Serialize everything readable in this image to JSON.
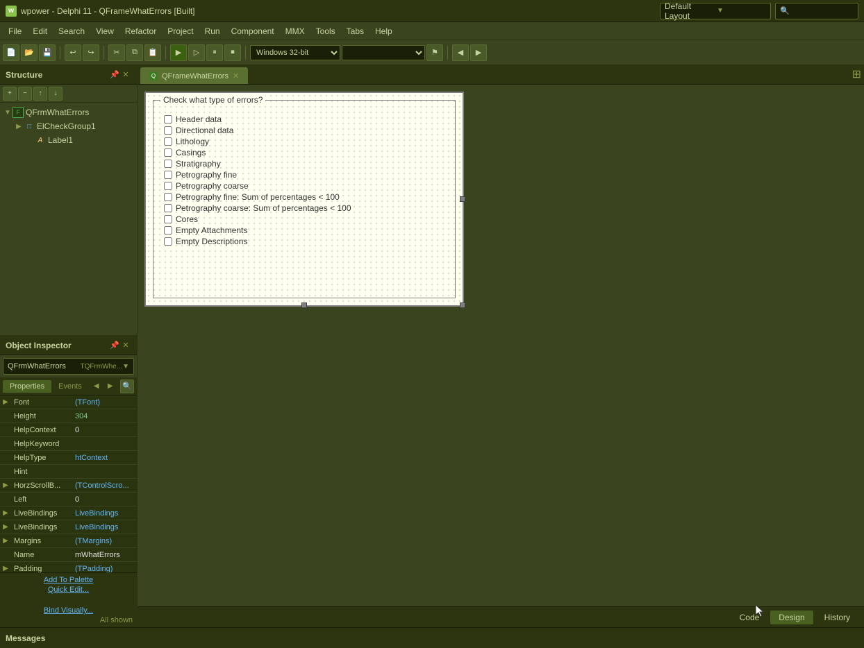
{
  "titlebar": {
    "icon": "w",
    "title": "wpower - Delphi 11 - QFrameWhatErrors [Built]",
    "layout_label": "Default Layout",
    "search_placeholder": "Search"
  },
  "menu": {
    "items": [
      "File",
      "Edit",
      "Search",
      "View",
      "Refactor",
      "Project",
      "Run",
      "Component",
      "MMX",
      "Tools",
      "Tabs",
      "Help"
    ]
  },
  "toolbar": {
    "platform_label": "Windows 32-bit"
  },
  "structure": {
    "title": "Structure",
    "tree_items": [
      {
        "indent": 0,
        "expand": "▼",
        "icon": "form",
        "label": "QFrmWhatErrors"
      },
      {
        "indent": 1,
        "expand": "▶",
        "icon": "group",
        "label": "ElCheckGroup1"
      },
      {
        "indent": 3,
        "expand": "",
        "icon": "label",
        "label": "Label1"
      }
    ]
  },
  "object_inspector": {
    "title": "Object Inspector",
    "selector_name": "QFrmWhatErrors",
    "selector_type": "TQFrmWhe...",
    "tabs": [
      "Properties",
      "Events"
    ],
    "properties": [
      {
        "expand": "▶",
        "name": "Font",
        "value": "(TFont)",
        "value_type": "blue"
      },
      {
        "expand": "",
        "name": "Height",
        "value": "304",
        "value_type": "green"
      },
      {
        "expand": "",
        "name": "HelpContext",
        "value": "0",
        "value_type": "normal"
      },
      {
        "expand": "",
        "name": "HelpKeyword",
        "value": "",
        "value_type": "normal"
      },
      {
        "expand": "",
        "name": "HelpType",
        "value": "htContext",
        "value_type": "blue"
      },
      {
        "expand": "",
        "name": "Hint",
        "value": "",
        "value_type": "normal"
      },
      {
        "expand": "▶",
        "name": "HorzScrollB...",
        "value": "(TControlScro...",
        "value_type": "blue"
      },
      {
        "expand": "",
        "name": "Left",
        "value": "0",
        "value_type": "normal"
      },
      {
        "expand": "▶",
        "name": "LiveBindings",
        "value": "LiveBindings",
        "value_type": "blue"
      },
      {
        "expand": "▶",
        "name": "LiveBindings",
        "value": "LiveBindings",
        "value_type": "blue"
      },
      {
        "expand": "▶",
        "name": "Margins",
        "value": "(TMargins)",
        "value_type": "blue"
      },
      {
        "expand": "",
        "name": "Name",
        "value": "mWhatErrors",
        "value_type": "normal"
      },
      {
        "expand": "▶",
        "name": "Padding",
        "value": "(TPadding)",
        "value_type": "blue"
      }
    ],
    "bottom_buttons": [
      "Add To Palette",
      "Quick Edit..."
    ],
    "bottom_buttons2": [
      "Bind Visually..."
    ],
    "all_shown": "All shown"
  },
  "editor": {
    "tab_label": "QFrameWhatErrors",
    "tab_modified": false
  },
  "form_design": {
    "group_title": "Check what type of errors?",
    "checkboxes": [
      "Header data",
      "Directional data",
      "Lithology",
      "Casings",
      "Stratigraphy",
      "Petrography fine",
      "Petrography coarse",
      "Petrography fine: Sum of percentages < 100",
      "Petrography coarse: Sum of percentages < 100",
      "Cores",
      "Empty Attachments",
      "Empty Descriptions"
    ]
  },
  "bottom_tabs": {
    "items": [
      "Code",
      "Design",
      "History"
    ],
    "active": "Design"
  },
  "messages": {
    "label": "Messages"
  }
}
